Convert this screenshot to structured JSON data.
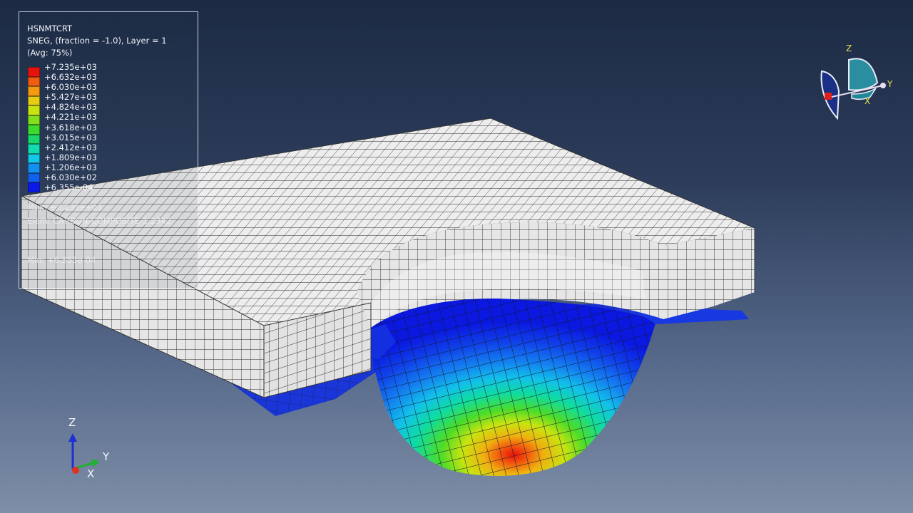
{
  "legend": {
    "title": "HSNMTCRT",
    "subtitle": "SNEG, (fraction = -1.0), Layer = 1",
    "average": "(Avg: 75%)",
    "ticks": [
      "+7.235e+03",
      "+6.632e+03",
      "+6.030e+03",
      "+5.427e+03",
      "+4.824e+03",
      "+4.221e+03",
      "+3.618e+03",
      "+3.015e+03",
      "+2.412e+03",
      "+1.809e+03",
      "+1.206e+03",
      "+6.030e+02",
      "+6.355e-04"
    ],
    "colors": [
      "#e8120c",
      "#f25c0e",
      "#f59a10",
      "#e6cd12",
      "#c8e410",
      "#82e01a",
      "#3cdb2c",
      "#18d86a",
      "#10dcb0",
      "#12c8e8",
      "#1090f0",
      "#1060f0",
      "#0a18e8"
    ],
    "max_label": "Max: +7.235e+03",
    "elem_label": "Elem: CARBON-COMPOSITE-1.2342",
    "min_label": "Min: +6.355e-04"
  },
  "triad_bottom": {
    "z": "Z",
    "y": "Y",
    "x": "X"
  },
  "triad_top": {
    "z": "Z",
    "y": "Y",
    "x": "X"
  },
  "colors": {
    "background_top": "#1c2a44",
    "background_bottom": "#7e8ea8",
    "plate": "#eeeeee",
    "mesh_lines": "#222222",
    "base_layer": "#1d3be0"
  }
}
